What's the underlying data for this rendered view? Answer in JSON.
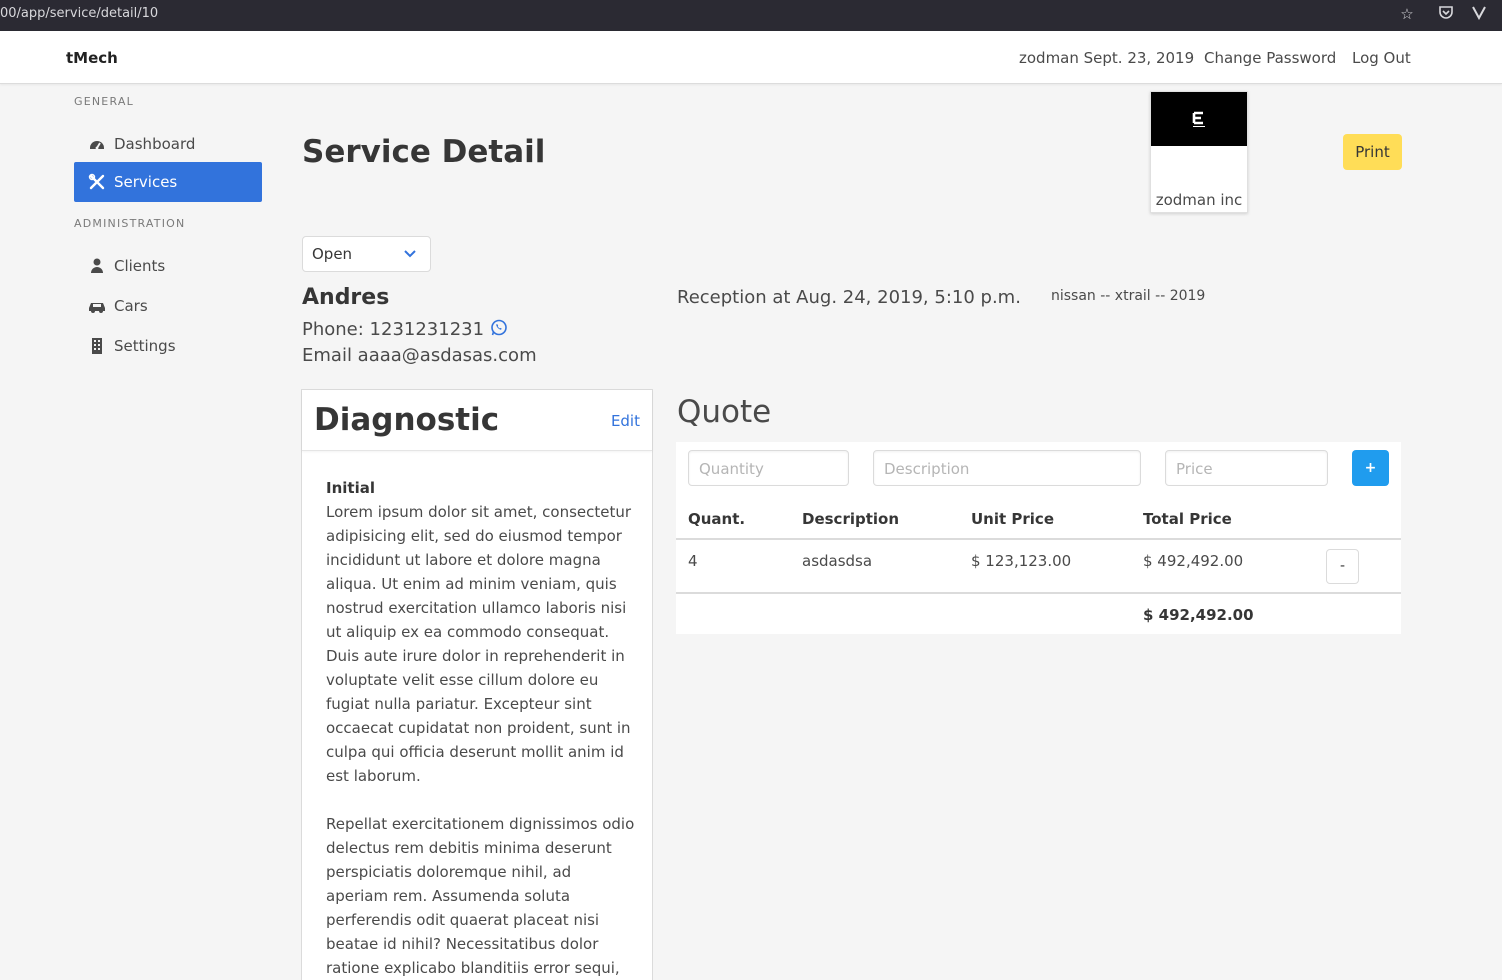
{
  "browser": {
    "url": "00/app/service/detail/10",
    "icons": [
      "star-icon",
      "pocket-icon",
      "vivaldi-menu-icon"
    ]
  },
  "navbar": {
    "brand": "tMech",
    "user_date": "zodman Sept. 23, 2019",
    "change_password": "Change Password",
    "logout": "Log Out"
  },
  "sidebar": {
    "general_label": "GENERAL",
    "admin_label": "ADMINISTRATION",
    "items": [
      {
        "label": "Dashboard",
        "icon": "dashboard-icon",
        "active": false
      },
      {
        "label": "Services",
        "icon": "tools-icon",
        "active": true
      },
      {
        "label": "Clients",
        "icon": "user-icon",
        "active": false
      },
      {
        "label": "Cars",
        "icon": "car-icon",
        "active": false
      },
      {
        "label": "Settings",
        "icon": "building-icon",
        "active": false
      }
    ]
  },
  "page": {
    "title": "Service Detail",
    "print_label": "Print",
    "company_name": "zodman inc",
    "status_value": "Open"
  },
  "client": {
    "name": "Andres",
    "phone": "Phone: 1231231231",
    "email": "Email aaaa@asdasas.com",
    "reception": "Reception at Aug. 24, 2019, 5:10 p.m.",
    "car": "nissan -- xtrail -- 2019"
  },
  "diagnostic": {
    "title": "Diagnostic",
    "edit_label": "Edit",
    "subtitle": "Initial",
    "paragraph1": "Lorem ipsum dolor sit amet, consectetur adipisicing elit, sed do eiusmod tempor incididunt ut labore et dolore magna aliqua. Ut enim ad minim veniam, quis nostrud exercitation ullamco laboris nisi ut aliquip ex ea commodo consequat. Duis aute irure dolor in reprehenderit in voluptate velit esse cillum dolore eu fugiat nulla pariatur. Excepteur sint occaecat cupidatat non proident, sunt in culpa qui officia deserunt mollit anim id est laborum.",
    "paragraph2": "Repellat exercitationem dignissimos odio delectus rem debitis minima deserunt perspiciatis doloremque nihil, ad aperiam rem. Assumenda soluta perferendis odit quaerat placeat nisi beatae id nihil? Necessitatibus dolor ratione explicabo blanditiis error sequi, temporibus culpa unde esse, veniam voluptatibus at vel velit"
  },
  "quote": {
    "title": "Quote",
    "quantity_placeholder": "Quantity",
    "description_placeholder": "Description",
    "price_placeholder": "Price",
    "add_label": "+",
    "columns": [
      "Quant.",
      "Description",
      "Unit Price",
      "Total Price"
    ],
    "rows": [
      {
        "quantity": "4",
        "description": "asdasdsa",
        "unit_price": "$ 123,123.00",
        "total_price": "$ 492,492.00",
        "remove_label": "-"
      }
    ],
    "grand_total": "$ 492,492.00"
  },
  "colors": {
    "accent": "#3273dc",
    "print_button": "#ffdd57",
    "add_button": "#209cee",
    "whatsapp": "#3273dc"
  }
}
